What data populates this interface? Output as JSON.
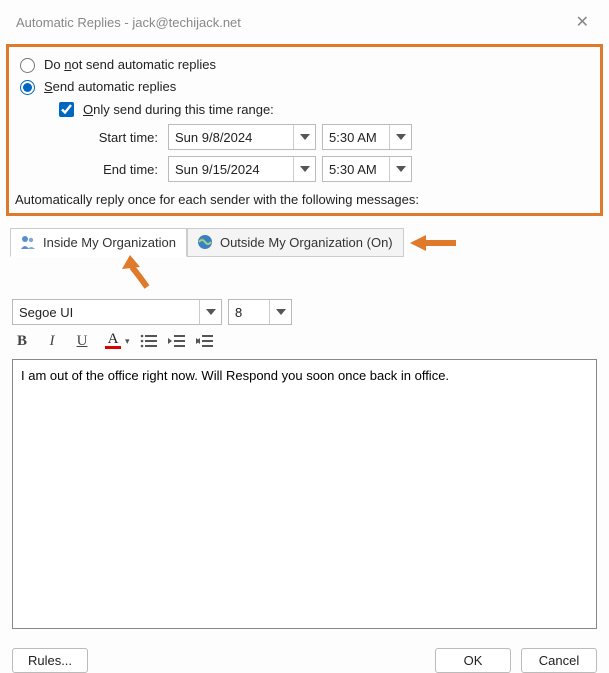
{
  "titlebar": {
    "title": "Automatic Replies - jack@techijack.net"
  },
  "radios": {
    "do_not_send_pre": "Do ",
    "do_not_send_key": "n",
    "do_not_send_post": "ot send automatic replies",
    "send_key": "S",
    "send_post": "end automatic replies",
    "send_selected": true
  },
  "check": {
    "only_key": "O",
    "only_post": "nly send during this time range:",
    "checked": true
  },
  "time": {
    "start_label": "Start time:",
    "end_label": "End time:",
    "start_date": "Sun 9/8/2024",
    "start_time": "5:30 AM",
    "end_date": "Sun 9/15/2024",
    "end_time": "5:30 AM"
  },
  "section_msg": "Automatically reply once for each sender with the following messages:",
  "tabs": {
    "inside": "Inside My Organization",
    "outside": "Outside My Organization (On)"
  },
  "editor": {
    "font_name": "Segoe UI",
    "font_size": "8",
    "body": "I am out of the office right now. Will Respond you soon once back in office."
  },
  "footer": {
    "rules": "Rules...",
    "ok": "OK",
    "cancel": "Cancel"
  }
}
